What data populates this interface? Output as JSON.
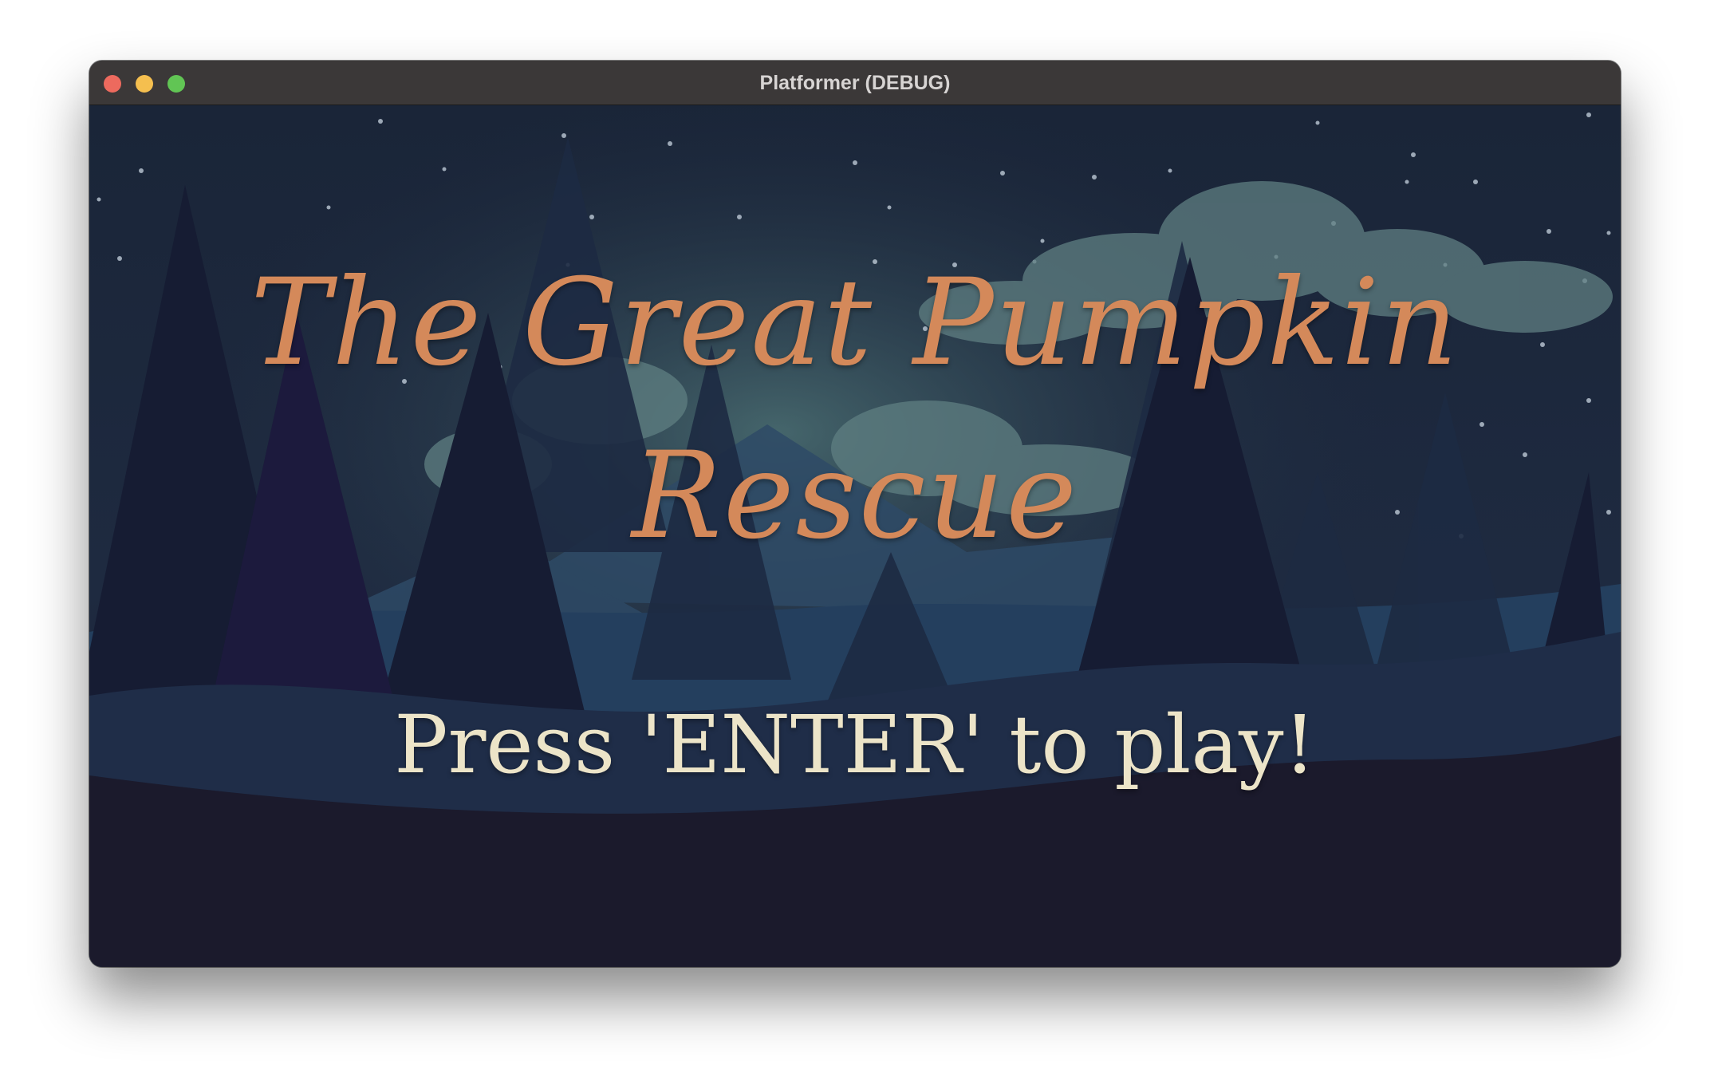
{
  "window": {
    "title": "Platformer (DEBUG)"
  },
  "game": {
    "title_line1": "The Great Pumpkin",
    "title_line2": "Rescue",
    "prompt": "Press 'ENTER' to play!"
  },
  "colors": {
    "title": "#d4895a",
    "prompt": "#ece4c8",
    "sky": "#1b2434",
    "ground": "#1b1a2c"
  }
}
